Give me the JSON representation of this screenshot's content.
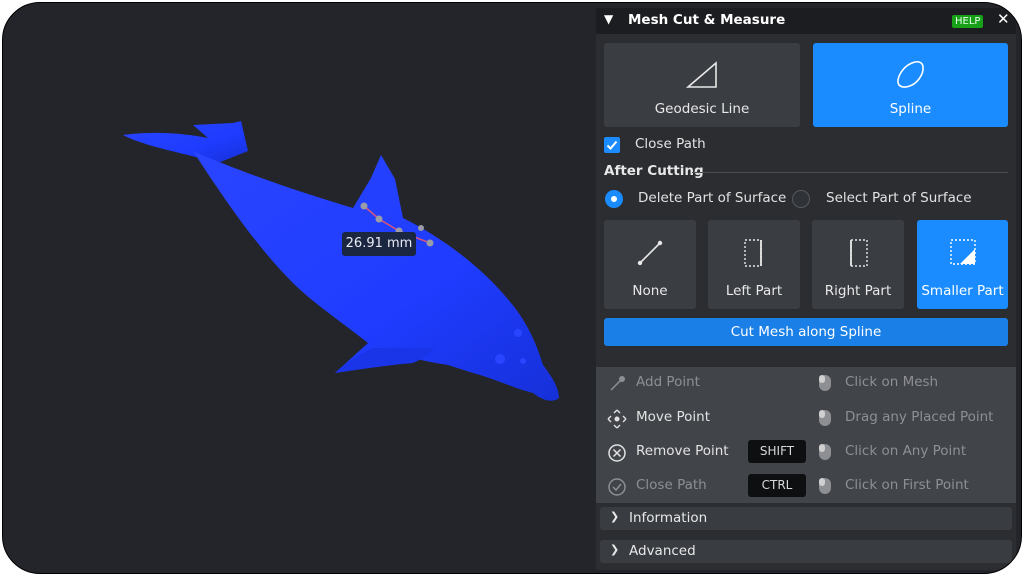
{
  "viewport": {
    "measurement": "26.91 mm",
    "model_color": "#1f3cff"
  },
  "panel": {
    "title": "Mesh Cut & Measure",
    "help": "HELP",
    "close_icon": "close-icon",
    "modes": [
      {
        "label": "Geodesic Line",
        "icon": "triangle-icon",
        "active": false
      },
      {
        "label": "Spline",
        "icon": "spline-shape-icon",
        "active": true
      }
    ],
    "close_path": {
      "label": "Close Path",
      "checked": true
    },
    "after_cutting": {
      "title": "After Cutting",
      "options": [
        {
          "label": "Delete Part of Surface",
          "selected": true
        },
        {
          "label": "Select Part of Surface",
          "selected": false
        }
      ]
    },
    "parts": [
      {
        "label": "None",
        "icon": "line-icon",
        "active": false
      },
      {
        "label": "Left Part",
        "icon": "left-part-icon",
        "active": false
      },
      {
        "label": "Right Part",
        "icon": "right-part-icon",
        "active": false
      },
      {
        "label": "Smaller Part",
        "icon": "smaller-part-icon",
        "active": true
      }
    ],
    "cut_button": "Cut Mesh along Spline",
    "hints": [
      {
        "action": "Add Point",
        "key": "",
        "mouse": "Click on Mesh",
        "enabled": false
      },
      {
        "action": "Move Point",
        "key": "",
        "mouse": "Drag any Placed Point",
        "enabled": true
      },
      {
        "action": "Remove Point",
        "key": "SHIFT",
        "mouse": "Click on Any Point",
        "enabled": true
      },
      {
        "action": "Close Path",
        "key": "CTRL",
        "mouse": "Click on First Point",
        "enabled": false
      }
    ],
    "sections": [
      {
        "label": "Information"
      },
      {
        "label": "Advanced"
      }
    ],
    "colors": {
      "accent": "#1a8cff",
      "help_bg": "#18a018"
    }
  }
}
